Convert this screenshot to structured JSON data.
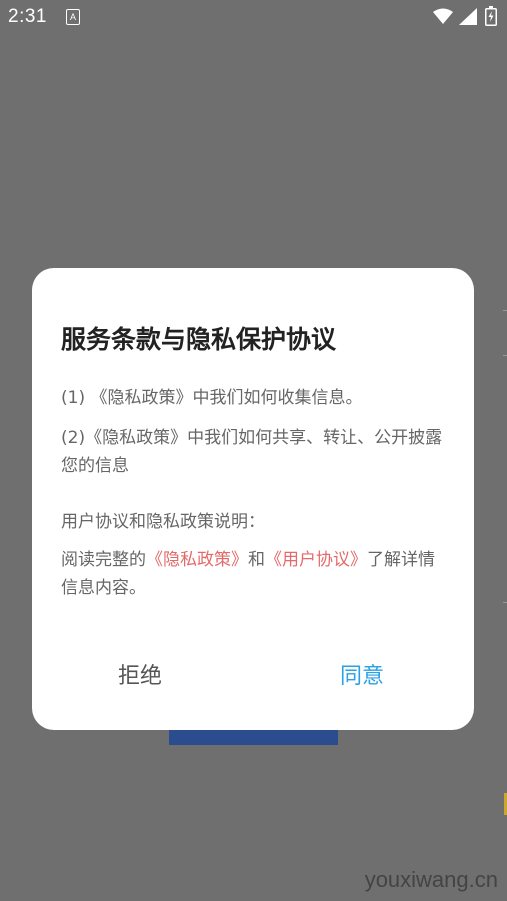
{
  "status_bar": {
    "time": "2:31",
    "notification_icon": "A",
    "icons": [
      "wifi-icon",
      "signal-icon",
      "battery-icon"
    ]
  },
  "dialog": {
    "title": "服务条款与隐私保护协议",
    "item1": "(1) 《隐私政策》中我们如何收集信息。",
    "item2": "(2)《隐私政策》中我们如何共享、转让、公开披露您的信息",
    "section_heading": "用户协议和隐私政策说明：",
    "read_prefix": "阅读完整的",
    "privacy_link": "《隐私政策》",
    "and_text": "和",
    "user_agreement_link": "《用户协议》",
    "read_suffix": "了解详情信息内容。",
    "reject_label": "拒绝",
    "agree_label": "同意"
  },
  "watermark": "youxiwang.cn",
  "colors": {
    "overlay": "#6f6f6f",
    "link": "#e46a6a",
    "agree": "#2aa0e6",
    "underlying_button": "#2b4d8f"
  }
}
